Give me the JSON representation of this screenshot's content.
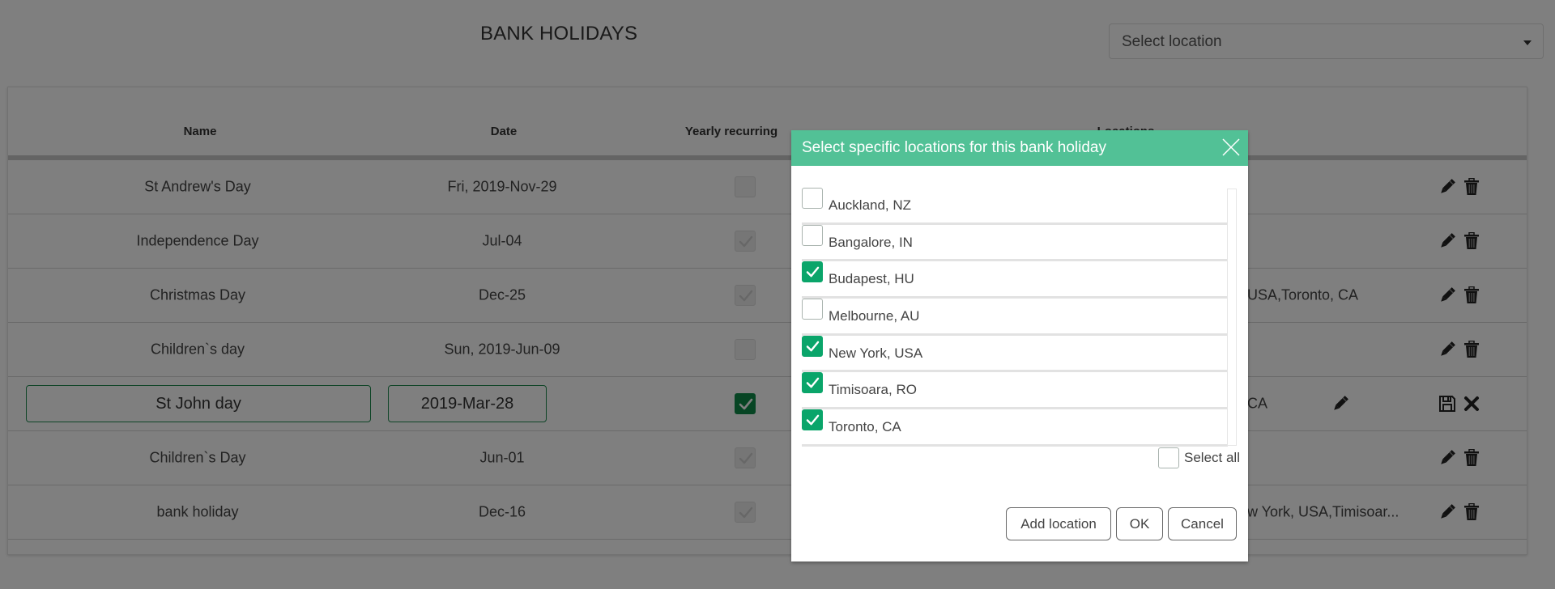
{
  "page": {
    "title": "BANK HOLIDAYS",
    "location_select": {
      "placeholder": "Select location"
    }
  },
  "table": {
    "columns": {
      "name": "Name",
      "date": "Date",
      "recurring": "Yearly recurring",
      "locations": "Locations"
    },
    "rows": [
      {
        "name": "St Andrew's Day",
        "date": "Fri, 2019-Nov-29",
        "recurring": false,
        "locations": ""
      },
      {
        "name": "Independence Day",
        "date": "Jul-04",
        "recurring": true,
        "locations": ""
      },
      {
        "name": "Christmas Day",
        "date": "Dec-25",
        "recurring": true,
        "locations": "USA,Toronto, CA"
      },
      {
        "name": "Children`s day",
        "date": "Sun, 2019-Jun-09",
        "recurring": false,
        "locations": ""
      },
      {
        "name": "St John day",
        "date": "2019-Mar-28",
        "recurring": true,
        "locations": "CA",
        "editing": true
      },
      {
        "name": "Children`s Day",
        "date": "Jun-01",
        "recurring": true,
        "locations": ""
      },
      {
        "name": "bank holiday",
        "date": "Dec-16",
        "recurring": true,
        "locations": "w York, USA,Timisoar..."
      }
    ]
  },
  "icons": {
    "edit": "pencil-icon",
    "delete": "trash-icon",
    "save": "floppy-disk-icon",
    "cancel": "close-x-icon",
    "dropdown": "caret-down-icon"
  },
  "modal": {
    "title": "Select specific locations for this bank holiday",
    "locations": [
      {
        "label": "Auckland, NZ",
        "checked": false
      },
      {
        "label": "Bangalore, IN",
        "checked": false
      },
      {
        "label": "Budapest, HU",
        "checked": true
      },
      {
        "label": "Melbourne, AU",
        "checked": false
      },
      {
        "label": "New York, USA",
        "checked": true
      },
      {
        "label": "Timisoara, RO",
        "checked": true
      },
      {
        "label": "Toronto, CA",
        "checked": true
      }
    ],
    "select_all": {
      "label": "Select all",
      "checked": false
    },
    "buttons": {
      "add_location": "Add location",
      "ok": "OK",
      "cancel": "Cancel"
    }
  },
  "colors": {
    "modal_header": "#52c196",
    "checkbox_checked": "#0aa56a",
    "overlay": "rgba(0,0,0,0.5)"
  }
}
